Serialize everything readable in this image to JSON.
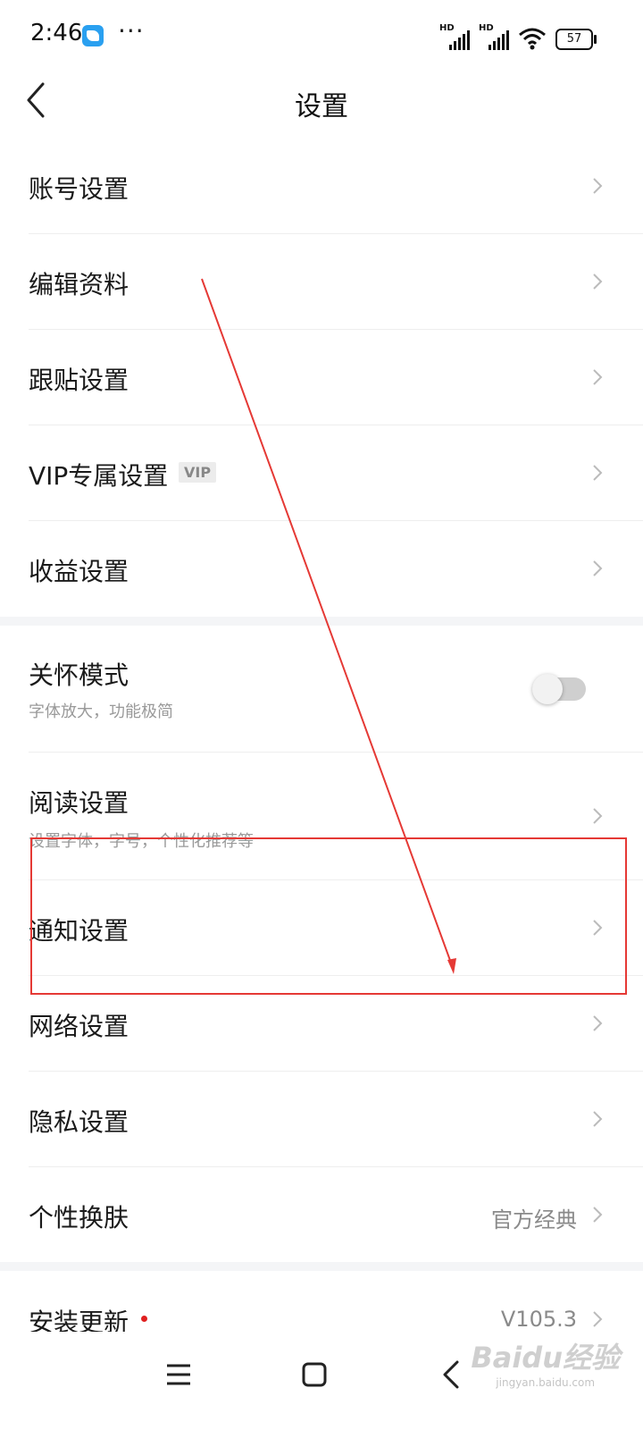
{
  "status_bar": {
    "time": "2:46",
    "dots": "···",
    "signal1_label": "HD",
    "signal2_label": "HD",
    "battery": "57"
  },
  "header": {
    "title": "设置"
  },
  "settings": {
    "account": "账号设置",
    "profile": "编辑资料",
    "reply": "跟贴设置",
    "vip": "VIP专属设置",
    "vip_badge": "VIP",
    "income": "收益设置",
    "care_mode": "关怀模式",
    "care_mode_desc": "字体放大，功能极简",
    "care_mode_on": false,
    "reading": "阅读设置",
    "reading_desc": "设置字体，字号，个性化推荐等",
    "notification": "通知设置",
    "network": "网络设置",
    "privacy": "隐私设置",
    "skin": "个性换肤",
    "skin_value": "官方经典",
    "update": "安装更新",
    "update_value": "V105.3"
  },
  "watermark": {
    "main": "Baidu经验",
    "sub": "jingyan.baidu.com"
  },
  "colors": {
    "annotation": "#e53935",
    "badge_dot": "#e02020",
    "toggle_off": "#cfcfcf"
  },
  "icons": [
    "app-icon",
    "more-dots-icon",
    "signal-icon",
    "wifi-icon",
    "battery-icon",
    "back-arrow-icon",
    "chevron-right-icon",
    "menu-icon",
    "home-icon",
    "back-icon"
  ]
}
